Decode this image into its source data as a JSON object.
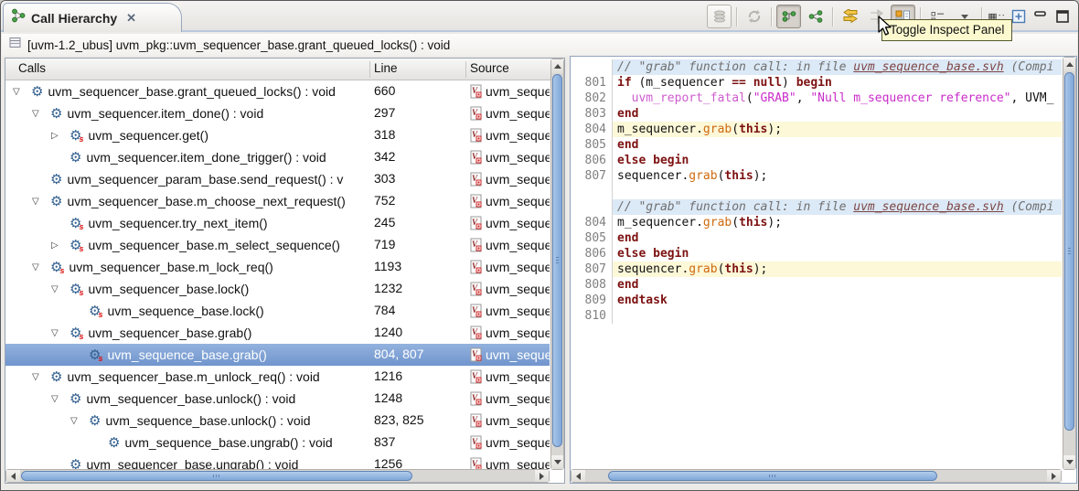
{
  "tab": {
    "title": "Call Hierarchy",
    "close_glyph": "✕"
  },
  "toolbar": {
    "tooltip": "Toggle Inspect Panel",
    "icons": [
      "history-icon",
      "refresh-icon",
      "caller-hierarchy-icon",
      "callee-hierarchy-icon",
      "swap-caller-callee-icon",
      "expand-icon",
      "toggle-inspect-panel-icon",
      "view-menu-icon",
      "chevron-down-icon",
      "focus-icon",
      "detach-icon",
      "minimize-icon",
      "maximize-icon"
    ],
    "focus_glyph": "▦::"
  },
  "info_bar": {
    "label": "[uvm-1.2_ubus] uvm_pkg::uvm_sequencer_base.grant_queued_locks() : void"
  },
  "colors": {
    "selection": "#7b9cd1",
    "line_highlight": "#fcf8d8",
    "header_line_bg": "#dce9f6",
    "keyword": "#7d1111",
    "string": "#c92bc9",
    "call": "#cf6a10",
    "comment": "#6f6f6f"
  },
  "calls_table": {
    "columns": [
      "Calls",
      "Line",
      "Source"
    ],
    "source_text": "uvm_seque",
    "rows": [
      {
        "label": "uvm_sequencer_base.grant_queued_locks() : void",
        "line": "660",
        "level": 0,
        "expander": "expanded",
        "task": false,
        "selected": false
      },
      {
        "label": "uvm_sequencer.item_done() : void",
        "line": "297",
        "level": 1,
        "expander": "expanded",
        "task": false,
        "selected": false
      },
      {
        "label": "uvm_sequencer.get()",
        "line": "318",
        "level": 2,
        "expander": "collapsed",
        "task": true,
        "selected": false
      },
      {
        "label": "uvm_sequencer.item_done_trigger() : void",
        "line": "342",
        "level": 2,
        "expander": "none",
        "task": false,
        "selected": false
      },
      {
        "label": "uvm_sequencer_param_base.send_request() : v",
        "line": "303",
        "level": 1,
        "expander": "none",
        "task": false,
        "selected": false
      },
      {
        "label": "uvm_sequencer_base.m_choose_next_request()",
        "line": "752",
        "level": 1,
        "expander": "expanded",
        "task": false,
        "selected": false
      },
      {
        "label": "uvm_sequencer.try_next_item()",
        "line": "245",
        "level": 2,
        "expander": "none",
        "task": true,
        "selected": false
      },
      {
        "label": "uvm_sequencer_base.m_select_sequence()",
        "line": "719",
        "level": 2,
        "expander": "collapsed",
        "task": true,
        "selected": false
      },
      {
        "label": "uvm_sequencer_base.m_lock_req()",
        "line": "1193",
        "level": 1,
        "expander": "expanded",
        "task": true,
        "selected": false
      },
      {
        "label": "uvm_sequencer_base.lock()",
        "line": "1232",
        "level": 2,
        "expander": "expanded",
        "task": true,
        "selected": false
      },
      {
        "label": "uvm_sequence_base.lock()",
        "line": "784",
        "level": 3,
        "expander": "none",
        "task": true,
        "selected": false
      },
      {
        "label": "uvm_sequencer_base.grab()",
        "line": "1240",
        "level": 2,
        "expander": "expanded",
        "task": true,
        "selected": false
      },
      {
        "label": "uvm_sequence_base.grab()",
        "line": "804, 807",
        "level": 3,
        "expander": "none",
        "task": true,
        "selected": true
      },
      {
        "label": "uvm_sequencer_base.m_unlock_req() : void",
        "line": "1216",
        "level": 1,
        "expander": "expanded",
        "task": false,
        "selected": false
      },
      {
        "label": "uvm_sequencer_base.unlock() : void",
        "line": "1248",
        "level": 2,
        "expander": "expanded",
        "task": false,
        "selected": false
      },
      {
        "label": "uvm_sequence_base.unlock() : void",
        "line": "823, 825",
        "level": 3,
        "expander": "expanded",
        "task": false,
        "selected": false
      },
      {
        "label": "uvm_sequence_base.ungrab() : void",
        "line": "837",
        "level": 4,
        "expander": "none",
        "task": false,
        "selected": false
      },
      {
        "label": "uvm_sequencer_base.ungrab() : void",
        "line": "1256",
        "level": 2,
        "expander": "none",
        "task": false,
        "selected": false
      }
    ]
  },
  "editor": {
    "lines": [
      {
        "num": "",
        "cls": "hdr",
        "segs": [
          [
            "c",
            "// \"grab\" function call: in file "
          ],
          [
            "l",
            "uvm_sequence_base.svh"
          ],
          [
            "c",
            " (Compi"
          ]
        ]
      },
      {
        "num": "801",
        "cls": "",
        "segs": [
          [
            "k",
            "if"
          ],
          [
            "p",
            " (m_sequencer "
          ],
          [
            "k",
            "=="
          ],
          [
            "p",
            " "
          ],
          [
            "k",
            "null"
          ],
          [
            "p",
            ") "
          ],
          [
            "k",
            "begin"
          ]
        ]
      },
      {
        "num": "802",
        "cls": "",
        "segs": [
          [
            "p",
            "  "
          ],
          [
            "f",
            "uvm_report_fatal"
          ],
          [
            "p",
            "("
          ],
          [
            "s",
            "\"GRAB\""
          ],
          [
            "p",
            ", "
          ],
          [
            "s",
            "\"Null m_sequencer reference\""
          ],
          [
            "p",
            ", UVM_"
          ]
        ]
      },
      {
        "num": "803",
        "cls": "",
        "segs": [
          [
            "k",
            "end"
          ]
        ]
      },
      {
        "num": "804",
        "cls": "hl",
        "segs": [
          [
            "p",
            "m_sequencer."
          ],
          [
            "o",
            "grab"
          ],
          [
            "p",
            "("
          ],
          [
            "k",
            "this"
          ],
          [
            "p",
            ");"
          ]
        ]
      },
      {
        "num": "805",
        "cls": "",
        "segs": [
          [
            "k",
            "end"
          ]
        ]
      },
      {
        "num": "806",
        "cls": "",
        "segs": [
          [
            "k",
            "else"
          ],
          [
            "p",
            " "
          ],
          [
            "k",
            "begin"
          ]
        ]
      },
      {
        "num": "807",
        "cls": "",
        "segs": [
          [
            "p",
            "sequencer."
          ],
          [
            "o",
            "grab"
          ],
          [
            "p",
            "("
          ],
          [
            "k",
            "this"
          ],
          [
            "p",
            ");"
          ]
        ]
      },
      {
        "num": "",
        "cls": "",
        "segs": []
      },
      {
        "num": "",
        "cls": "hdr",
        "segs": [
          [
            "c",
            "// \"grab\" function call: in file "
          ],
          [
            "l",
            "uvm_sequence_base.svh"
          ],
          [
            "c",
            " (Compi"
          ]
        ]
      },
      {
        "num": "804",
        "cls": "",
        "segs": [
          [
            "p",
            "m_sequencer."
          ],
          [
            "o",
            "grab"
          ],
          [
            "p",
            "("
          ],
          [
            "k",
            "this"
          ],
          [
            "p",
            ");"
          ]
        ]
      },
      {
        "num": "805",
        "cls": "",
        "segs": [
          [
            "k",
            "end"
          ]
        ]
      },
      {
        "num": "806",
        "cls": "",
        "segs": [
          [
            "k",
            "else"
          ],
          [
            "p",
            " "
          ],
          [
            "k",
            "begin"
          ]
        ]
      },
      {
        "num": "807",
        "cls": "hl",
        "segs": [
          [
            "p",
            "sequencer."
          ],
          [
            "o",
            "grab"
          ],
          [
            "p",
            "("
          ],
          [
            "k",
            "this"
          ],
          [
            "p",
            ");"
          ]
        ]
      },
      {
        "num": "808",
        "cls": "",
        "segs": [
          [
            "k",
            "end"
          ]
        ]
      },
      {
        "num": "809",
        "cls": "",
        "segs": [
          [
            "k",
            "endtask"
          ]
        ]
      },
      {
        "num": "810",
        "cls": "",
        "segs": []
      }
    ]
  }
}
